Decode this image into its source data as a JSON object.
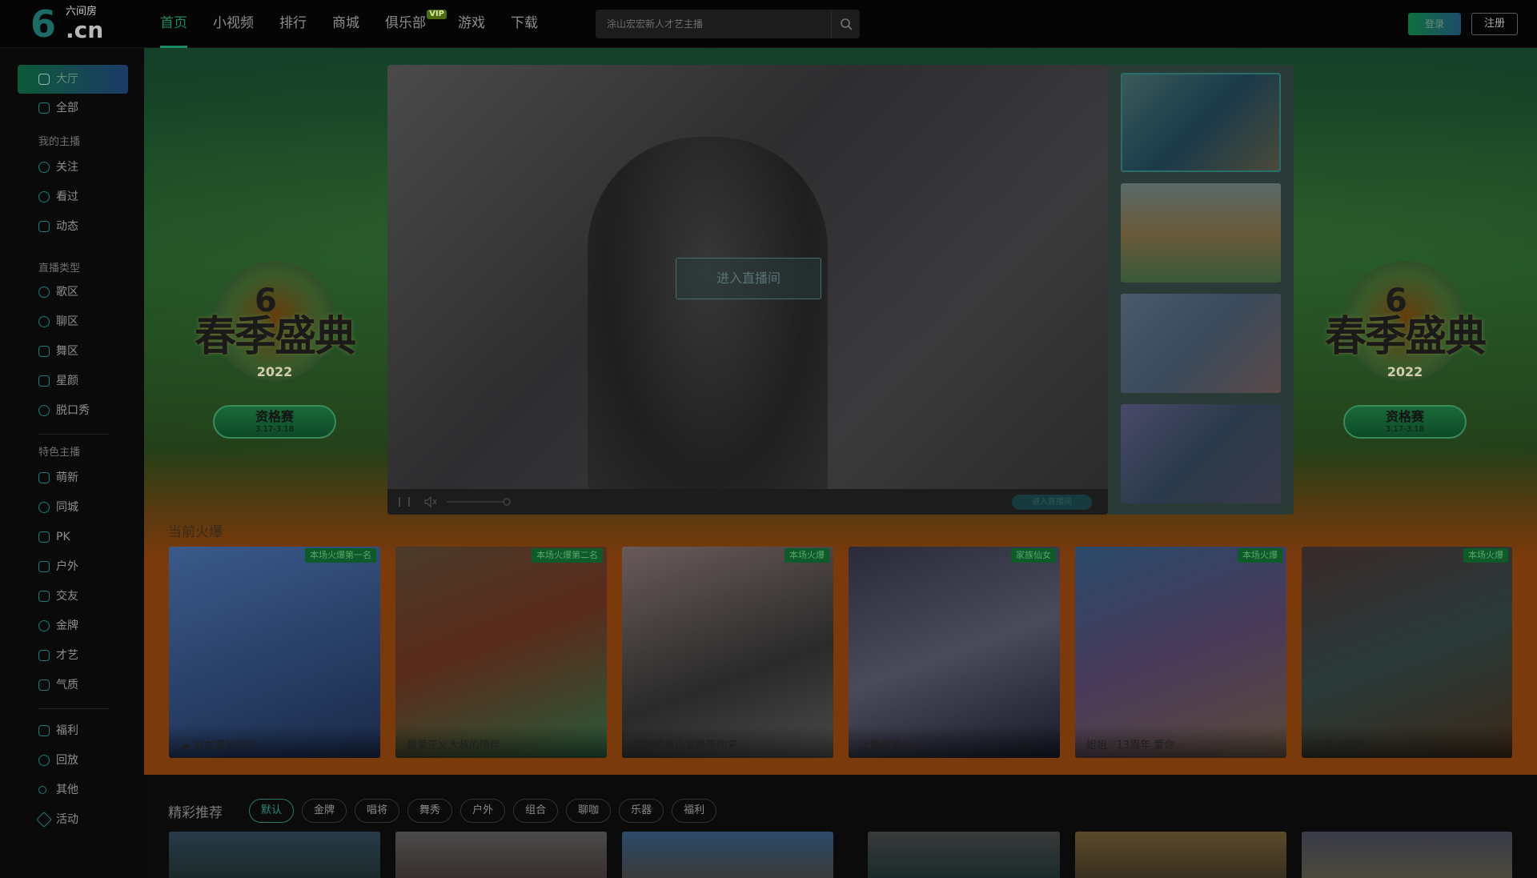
{
  "brand": {
    "logo_mark": "6",
    "logo_domain": ".cn",
    "logo_name": "六间房"
  },
  "nav": [
    {
      "label": "首页",
      "active": true
    },
    {
      "label": "小视频"
    },
    {
      "label": "排行"
    },
    {
      "label": "商城"
    },
    {
      "label": "俱乐部",
      "tag": "VIP"
    },
    {
      "label": "游戏"
    },
    {
      "label": "下载"
    }
  ],
  "search": {
    "placeholder": "涂山宏宏新人才艺主播",
    "icon": "search-icon"
  },
  "auth": {
    "login_label": "登录",
    "register_label": "注册"
  },
  "sidebar": {
    "top": [
      {
        "label": "大厅",
        "icon": "home-icon",
        "active": true
      },
      {
        "label": "全部",
        "icon": "grid-icon"
      }
    ],
    "section_my": "我的主播",
    "my": [
      {
        "label": "关注",
        "icon": "heart-icon"
      },
      {
        "label": "看过",
        "icon": "clock-icon"
      },
      {
        "label": "动态",
        "icon": "message-icon"
      }
    ],
    "section_type": "直播类型",
    "types": [
      {
        "label": "歌区",
        "icon": "music-icon"
      },
      {
        "label": "聊区",
        "icon": "chat-icon"
      },
      {
        "label": "舞区",
        "icon": "dance-icon"
      },
      {
        "label": "星颜",
        "icon": "mask-icon"
      },
      {
        "label": "脱口秀",
        "icon": "mic-icon"
      }
    ],
    "section_feature": "特色主播",
    "features": [
      {
        "label": "萌新",
        "icon": "sprout-icon"
      },
      {
        "label": "同城",
        "icon": "location-icon"
      },
      {
        "label": "PK",
        "icon": "bolt-icon"
      },
      {
        "label": "户外",
        "icon": "tent-icon"
      },
      {
        "label": "交友",
        "icon": "people-icon"
      },
      {
        "label": "金牌",
        "icon": "medal-icon"
      },
      {
        "label": "才艺",
        "icon": "palette-icon"
      },
      {
        "label": "气质",
        "icon": "shoe-icon"
      }
    ],
    "bottom": [
      {
        "label": "福利",
        "icon": "gift-icon"
      },
      {
        "label": "回放",
        "icon": "replay-icon"
      },
      {
        "label": "其他",
        "icon": "dots-icon"
      },
      {
        "label": "活动",
        "icon": "star-icon"
      }
    ]
  },
  "banner": {
    "event_title": "春季盛典",
    "event_year": "2022",
    "event_stage": "资格赛",
    "event_dates": "3.17-3.18"
  },
  "player": {
    "enter_label": "进入直播间",
    "go_live_label": "进入直播间"
  },
  "hot": {
    "title": "当前火爆",
    "cards": [
      {
        "caption": "☁ 仙女蜜加油呀",
        "badge": "本场火爆第一名",
        "colors": [
          "#3a5a8a",
          "#1a2a4a"
        ]
      },
      {
        "caption": "最爱正义大叔的陪伴",
        "badge": "本场火爆第二名",
        "colors": [
          "#4a2a1a",
          "#2a5a3a"
        ]
      },
      {
        "caption": "甜美歌者小蜜蜂等你来",
        "badge": "本场火爆",
        "colors": [
          "#5a4a4a",
          "#2a2a2a"
        ]
      },
      {
        "caption": "上瘾の娘儿",
        "badge": "家族仙女",
        "colors": [
          "#2a2a3a",
          "#4a4a5a"
        ]
      },
      {
        "caption": "姐姐♡13周年 爱你",
        "badge": "本场火爆",
        "colors": [
          "#2a4a6a",
          "#4a3a5a"
        ]
      },
      {
        "caption": "北家小黄蜂",
        "badge": "本场火爆",
        "colors": [
          "#2a3a3a",
          "#3a2a1a"
        ]
      }
    ]
  },
  "recommend": {
    "title": "精彩推荐",
    "filters": [
      {
        "label": "默认",
        "active": true
      },
      {
        "label": "金牌"
      },
      {
        "label": "唱将"
      },
      {
        "label": "舞秀"
      },
      {
        "label": "户外"
      },
      {
        "label": "组合"
      },
      {
        "label": "聊咖"
      },
      {
        "label": "乐器"
      },
      {
        "label": "福利"
      }
    ]
  },
  "colors": {
    "accent": "#1a8a60",
    "brand_teal": "#1f7a78"
  }
}
